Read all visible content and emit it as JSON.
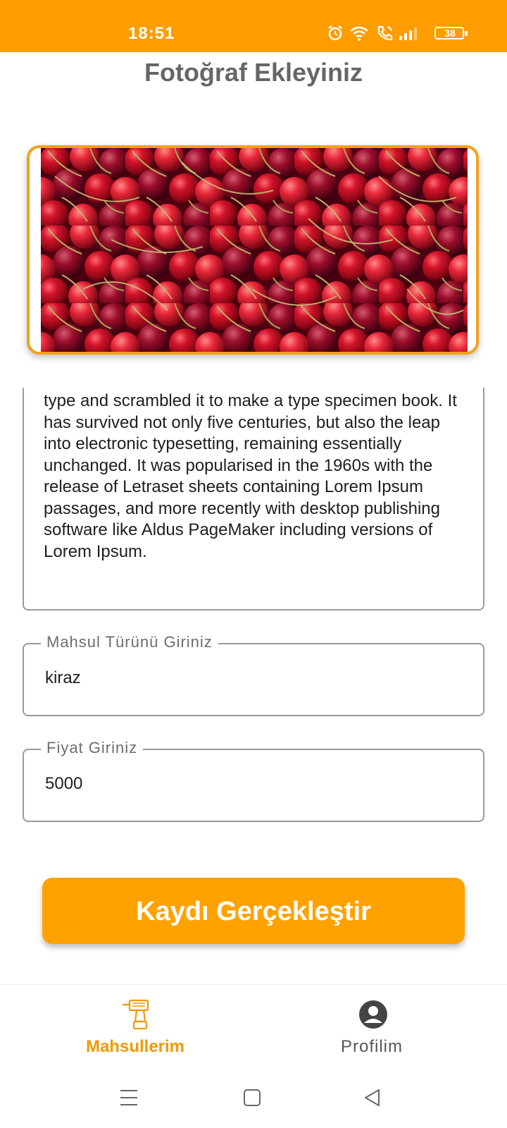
{
  "status_bar": {
    "time": "18:51",
    "battery": "38",
    "icons": [
      "alarm-icon",
      "wifi-icon",
      "call-icon",
      "signal-icon",
      "battery-icon"
    ],
    "background_color": "#ff9d00"
  },
  "page": {
    "title": "Fotoğraf Ekleyiniz"
  },
  "photo": {
    "subject": "cherries",
    "border_color": "#f3a21b"
  },
  "description": {
    "text": "type and scrambled it to make a type specimen book. It has survived not only five centuries, but also the leap into electronic typesetting, remaining essentially unchanged. It was popularised in the 1960s with the release of Letraset sheets containing Lorem Ipsum passages, and more recently with desktop publishing software like Aldus PageMaker including versions of Lorem Ipsum."
  },
  "fields": {
    "crop_type": {
      "label": "Mahsul Türünü Giriniz",
      "value": "kiraz"
    },
    "price": {
      "label": "Fiyat Giriniz",
      "value": "5000"
    }
  },
  "save_button": {
    "label": "Kaydı Gerçekleştir",
    "color": "#ffa200"
  },
  "bottom_nav": {
    "items": [
      {
        "label": "Mahsullerim",
        "icon": "drill-icon",
        "active": true
      },
      {
        "label": "Profilim",
        "icon": "account-circle-icon",
        "active": false
      }
    ],
    "active_color": "#f09a00"
  },
  "system_nav": {
    "buttons": [
      "menu-icon",
      "home-icon",
      "back-icon"
    ]
  }
}
